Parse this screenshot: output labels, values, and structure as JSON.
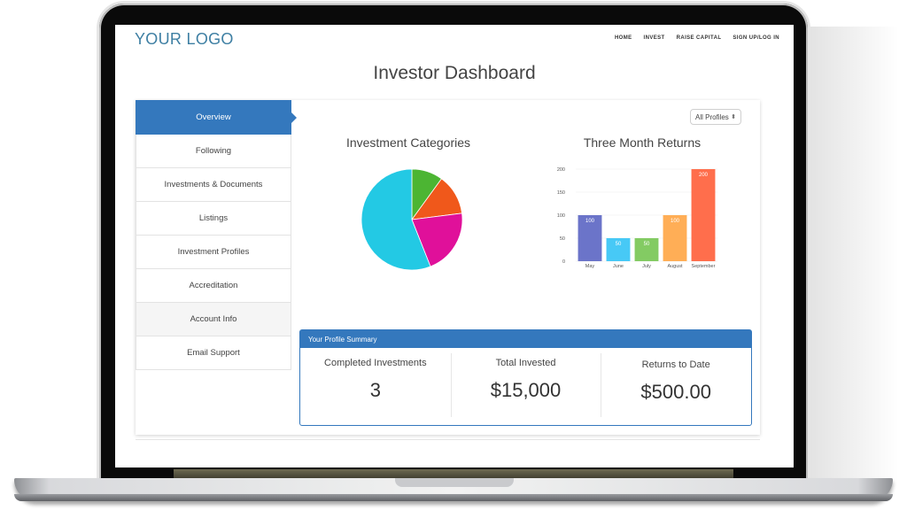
{
  "header": {
    "logo": "YOUR LOGO",
    "nav": [
      "HOME",
      "INVEST",
      "RAISE CAPITAL",
      "SIGN UP/LOG IN"
    ]
  },
  "page_title": "Investor Dashboard",
  "sidebar": {
    "active_index": 0,
    "items": [
      {
        "label": "Overview"
      },
      {
        "label": "Following"
      },
      {
        "label": "Investments & Documents"
      },
      {
        "label": "Listings"
      },
      {
        "label": "Investment Profiles"
      },
      {
        "label": "Accreditation"
      },
      {
        "label": "Account Info"
      },
      {
        "label": "Email Support"
      }
    ]
  },
  "profile_filter": {
    "selected": "All Profiles"
  },
  "colors": {
    "accent": "#3478bd",
    "logo": "#3e7fa3"
  },
  "chart_data": [
    {
      "type": "pie",
      "title": "Investment Categories",
      "slices": [
        {
          "label": "",
          "value": 10,
          "color": "#4cb533"
        },
        {
          "label": "",
          "value": 13,
          "color": "#f0581b"
        },
        {
          "label": "",
          "value": 21,
          "color": "#e0109a"
        },
        {
          "label": "",
          "value": 56,
          "color": "#23c9e4"
        }
      ]
    },
    {
      "type": "bar",
      "title": "Three Month Returns",
      "categories": [
        "May",
        "June",
        "July",
        "August",
        "September"
      ],
      "values": [
        100,
        50,
        50,
        100,
        200
      ],
      "colors": [
        "#6b74c9",
        "#47c9f6",
        "#83cb63",
        "#ffae56",
        "#ff6e4c"
      ],
      "ylim": [
        0,
        200
      ],
      "yticks": [
        0,
        50,
        100,
        150,
        200
      ],
      "grid": true,
      "data_labels": true,
      "xlabel": "",
      "ylabel": ""
    }
  ],
  "summary": {
    "heading": "Your Profile Summary",
    "stats": [
      {
        "label": "Completed Investments",
        "value": "3"
      },
      {
        "label": "Total Invested",
        "value": "$15,000"
      },
      {
        "label": "Returns to Date",
        "value": "$500.00"
      }
    ]
  }
}
